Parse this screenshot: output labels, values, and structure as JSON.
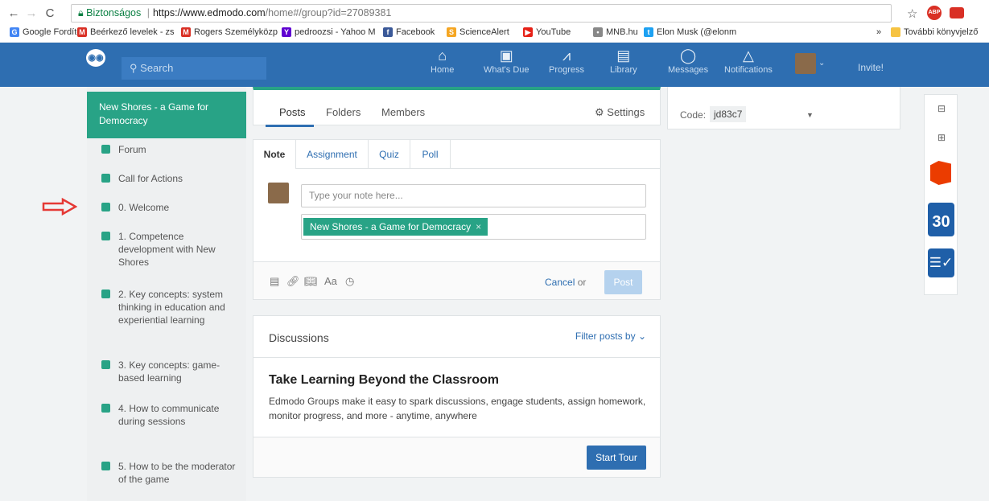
{
  "browser": {
    "secure_label": "Biztonságos",
    "url_host": "https://www.edmodo.com",
    "url_rest": "/home#/group?id=27089381",
    "bookmarks": [
      {
        "label": "Google Fordító",
        "color": "#4285f4",
        "icon": "G"
      },
      {
        "label": "Beérkező levelek - zs",
        "color": "#d93025",
        "icon": "M"
      },
      {
        "label": "Rogers Személyközp",
        "color": "#d93025",
        "icon": "M"
      },
      {
        "label": "pedroozsi - Yahoo M",
        "color": "#5f01d1",
        "icon": "Y"
      },
      {
        "label": "Facebook",
        "color": "#3b5998",
        "icon": "f"
      },
      {
        "label": "ScienceAlert",
        "color": "#f5a623",
        "icon": "S"
      },
      {
        "label": "YouTube",
        "color": "#e62117",
        "icon": "▶"
      },
      {
        "label": "MNB.hu",
        "color": "#888888",
        "icon": "•"
      },
      {
        "label": "Elon Musk (@elonm",
        "color": "#1da1f2",
        "icon": "t"
      }
    ],
    "more_bookmarks": "»",
    "other_bookmarks": "További könyvjelző",
    "ext1_label": "ABP"
  },
  "header": {
    "search_placeholder": "Search",
    "nav": [
      {
        "label": "Home",
        "icon": "⌂"
      },
      {
        "label": "What's Due",
        "icon": "▣"
      },
      {
        "label": "Progress",
        "icon": "⩘"
      },
      {
        "label": "Library",
        "icon": "▤"
      },
      {
        "label": "Messages",
        "icon": "◯"
      },
      {
        "label": "Notifications",
        "icon": "△"
      }
    ],
    "invite": "Invite!"
  },
  "sidebar": {
    "group_title": "New Shores - a Game for Democracy",
    "items": [
      {
        "label": "Forum"
      },
      {
        "label": "Call for Actions"
      },
      {
        "label": "0. Welcome"
      },
      {
        "label": "1. Competence development with New Shores"
      },
      {
        "label": "2. Key concepts: system thinking in education and experiential learning"
      },
      {
        "label": "3. Key concepts: game-based learning"
      },
      {
        "label": "4. How to communicate during sessions"
      },
      {
        "label": "5. How to be the moderator of the game"
      }
    ]
  },
  "tabs": {
    "posts": "Posts",
    "folders": "Folders",
    "members": "Members",
    "settings": "Settings"
  },
  "composer": {
    "tabs": [
      "Note",
      "Assignment",
      "Quiz",
      "Poll"
    ],
    "note_placeholder": "Type your note here...",
    "recipient_chip": "New Shores - a Game for Democracy",
    "chip_close": "×",
    "format_label": "Aa",
    "cancel": "Cancel",
    "or": "or",
    "post": "Post"
  },
  "discussions": {
    "title": "Discussions",
    "filter": "Filter posts by",
    "tour_title": "Take Learning Beyond the Classroom",
    "tour_text": "Edmodo Groups make it easy to spark discussions, engage students, assign homework, monitor progress, and more - anytime, anywhere",
    "start_tour": "Start Tour"
  },
  "code_card": {
    "label": "Code:",
    "value": "jd83c7"
  },
  "rail": {
    "calendar_day": "30"
  },
  "colors": {
    "brand_blue": "#2e6eb1",
    "group_green": "#28a386",
    "arrow_red": "#e53935"
  }
}
